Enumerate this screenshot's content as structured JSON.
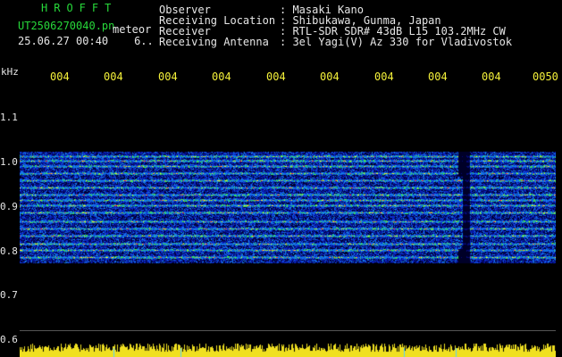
{
  "app_title": "HROFFT",
  "file_name": "UT2506270040.pn",
  "file_tag": "meteor",
  "datetime": "25.06.27 00:40",
  "datetime_extra": "6..",
  "info": [
    {
      "label": "Observer",
      "value": ": Masaki Kano"
    },
    {
      "label": "Receiving Location",
      "value": ": Shibukawa, Gunma, Japan"
    },
    {
      "label": "Receiver",
      "value": ": RTL-SDR SDR# 43dB L15 103.2MHz CW"
    },
    {
      "label": "Receiving Antenna",
      "value": ": 3el Yagi(V) Az 330 for Vladivostok"
    }
  ],
  "y_axis_unit": "kHz",
  "x_ticks": [
    "004",
    "004",
    "004",
    "004",
    "004",
    "004",
    "004",
    "004",
    "004",
    "0050"
  ],
  "y_ticks": [
    "1.1",
    "1.0",
    "0.9",
    "0.8",
    "0.7",
    "0.6"
  ],
  "colors": {
    "title_green": "#27d83a",
    "text_white": "#e6e6e6",
    "tick_yellow": "#f5f23a",
    "noise_blue": "#1e3cff",
    "echo_red": "#ff3030",
    "power_trace": "#f0e020",
    "marker_cyan": "#5ad0ff"
  }
}
